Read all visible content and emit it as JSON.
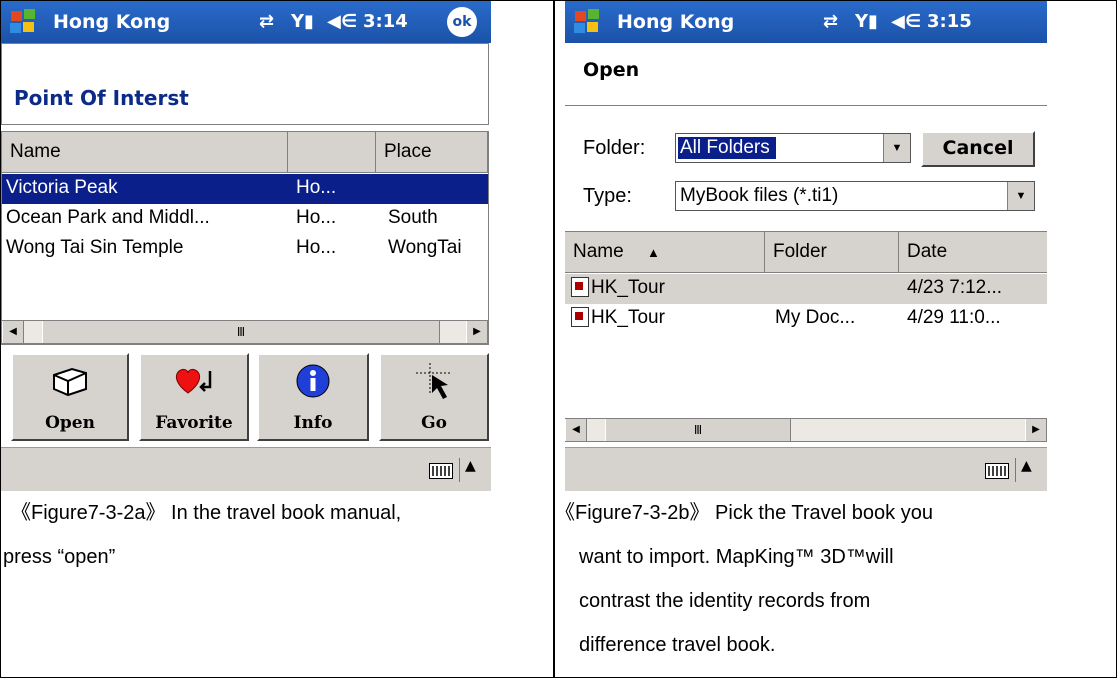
{
  "figure_a": {
    "status": {
      "title": "Hong Kong",
      "time": "3:14",
      "ok": "ok"
    },
    "heading": "Point Of Interst",
    "columns": [
      "Name",
      "",
      "Place"
    ],
    "rows": [
      {
        "name": "Victoria Peak",
        "region": "Ho...",
        "place": ""
      },
      {
        "name": "Ocean Park and Middl...",
        "region": "Ho...",
        "place": "South"
      },
      {
        "name": "Wong Tai Sin Temple",
        "region": "Ho...",
        "place": "WongTai"
      }
    ],
    "toolbar": {
      "open": "Open",
      "favorite": "Favorite",
      "info": "Info",
      "go": "Go"
    },
    "caption_line1": "《Figure7-3-2a》 In the travel book manual,",
    "caption_line2": "press “open”"
  },
  "figure_b": {
    "status": {
      "title": "Hong Kong",
      "time": "3:15"
    },
    "dialog_title": "Open",
    "folder_label": "Folder:",
    "folder_value": "All Folders",
    "cancel": "Cancel",
    "type_label": "Type:",
    "type_value": "MyBook files (*.ti1)",
    "columns": [
      "Name",
      "Folder",
      "Date"
    ],
    "sort_indicator": "▲",
    "rows": [
      {
        "name": "HK_Tour",
        "folder": "",
        "date": "4/23 7:12..."
      },
      {
        "name": "HK_Tour",
        "folder": "My Doc...",
        "date": "4/29 11:0..."
      }
    ],
    "caption_lines": [
      "《Figure7-3-2b》 Pick the Travel book you",
      "want to import. MapKing™ 3D™will",
      "contrast the identity records from",
      "difference travel book."
    ]
  }
}
